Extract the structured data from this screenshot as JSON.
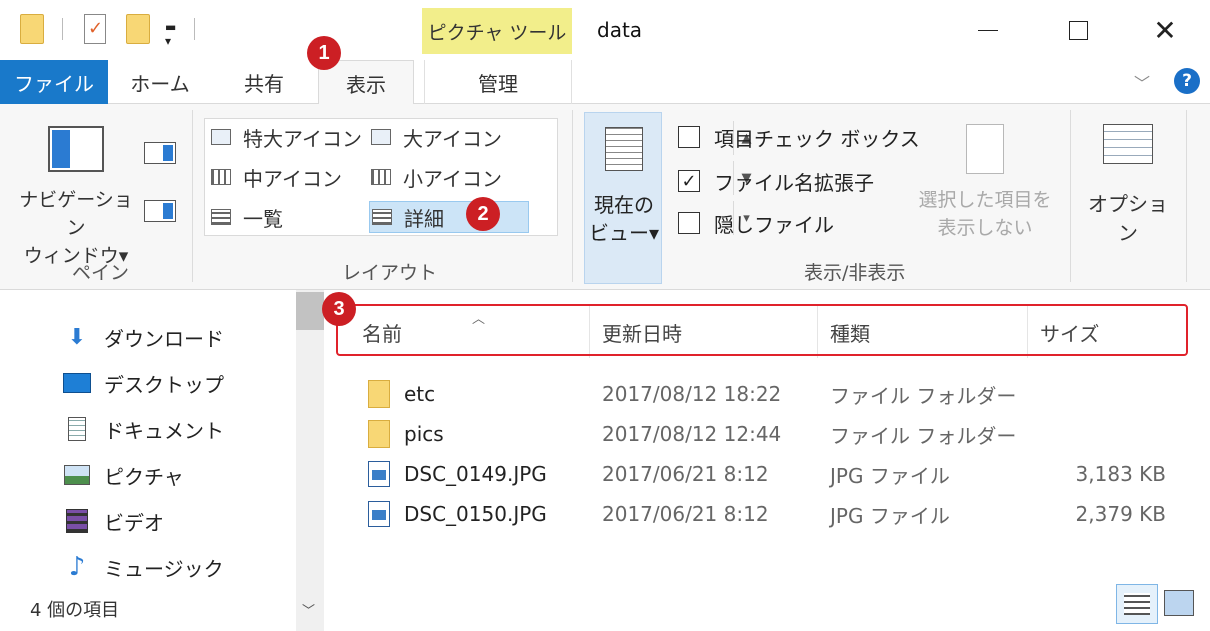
{
  "window": {
    "title": "data",
    "context_tab_header": "ピクチャ ツール"
  },
  "tabs": {
    "file": "ファイル",
    "home": "ホーム",
    "share": "共有",
    "view": "表示",
    "manage": "管理"
  },
  "ribbon": {
    "pane_group": {
      "nav_pane_label": "ナビゲーション\nウィンドウ▾",
      "group_label": "ペイン"
    },
    "layout_group": {
      "items": [
        "特大アイコン",
        "大アイコン",
        "中アイコン",
        "小アイコン",
        "一覧",
        "詳細"
      ],
      "selected": "詳細",
      "group_label": "レイアウト"
    },
    "current_view_label": "現在の\nビュー▾",
    "show_hide_group": {
      "item_checkboxes": {
        "label": "項目チェック ボックス",
        "checked": false
      },
      "file_extensions": {
        "label": "ファイル名拡張子",
        "checked": true
      },
      "hidden_files": {
        "label": "隠しファイル",
        "checked": false
      },
      "hide_selected_label": "選択した項目を\n表示しない",
      "group_label": "表示/非表示"
    },
    "options_label": "オプション"
  },
  "nav_pane": {
    "items": [
      {
        "label": "ダウンロード",
        "icon": "download-arrow-icon"
      },
      {
        "label": "デスクトップ",
        "icon": "desktop-icon"
      },
      {
        "label": "ドキュメント",
        "icon": "document-icon"
      },
      {
        "label": "ピクチャ",
        "icon": "picture-icon"
      },
      {
        "label": "ビデオ",
        "icon": "video-icon"
      },
      {
        "label": "ミュージック",
        "icon": "music-note-icon"
      }
    ],
    "status": "4 個の項目"
  },
  "file_list": {
    "columns": [
      "名前",
      "更新日時",
      "種類",
      "サイズ"
    ],
    "sorted_column": "名前",
    "rows": [
      {
        "name": "etc",
        "date": "2017/08/12 18:22",
        "type": "ファイル フォルダー",
        "size": "",
        "icon": "folder-icon"
      },
      {
        "name": "pics",
        "date": "2017/08/12 12:44",
        "type": "ファイル フォルダー",
        "size": "",
        "icon": "folder-icon"
      },
      {
        "name": "DSC_0149.JPG",
        "date": "2017/06/21 8:12",
        "type": "JPG ファイル",
        "size": "3,183 KB",
        "icon": "image-file-icon"
      },
      {
        "name": "DSC_0150.JPG",
        "date": "2017/06/21 8:12",
        "type": "JPG ファイル",
        "size": "2,379 KB",
        "icon": "image-file-icon"
      }
    ]
  },
  "annotations": {
    "badge_1": "1",
    "badge_2": "2",
    "badge_3": "3"
  },
  "colors": {
    "file_tab": "#1979ca",
    "context_tab": "#f2ee8b",
    "badge": "#cc1f24",
    "highlight_border": "#e0222b",
    "selected_layout": "#cce4f7"
  }
}
